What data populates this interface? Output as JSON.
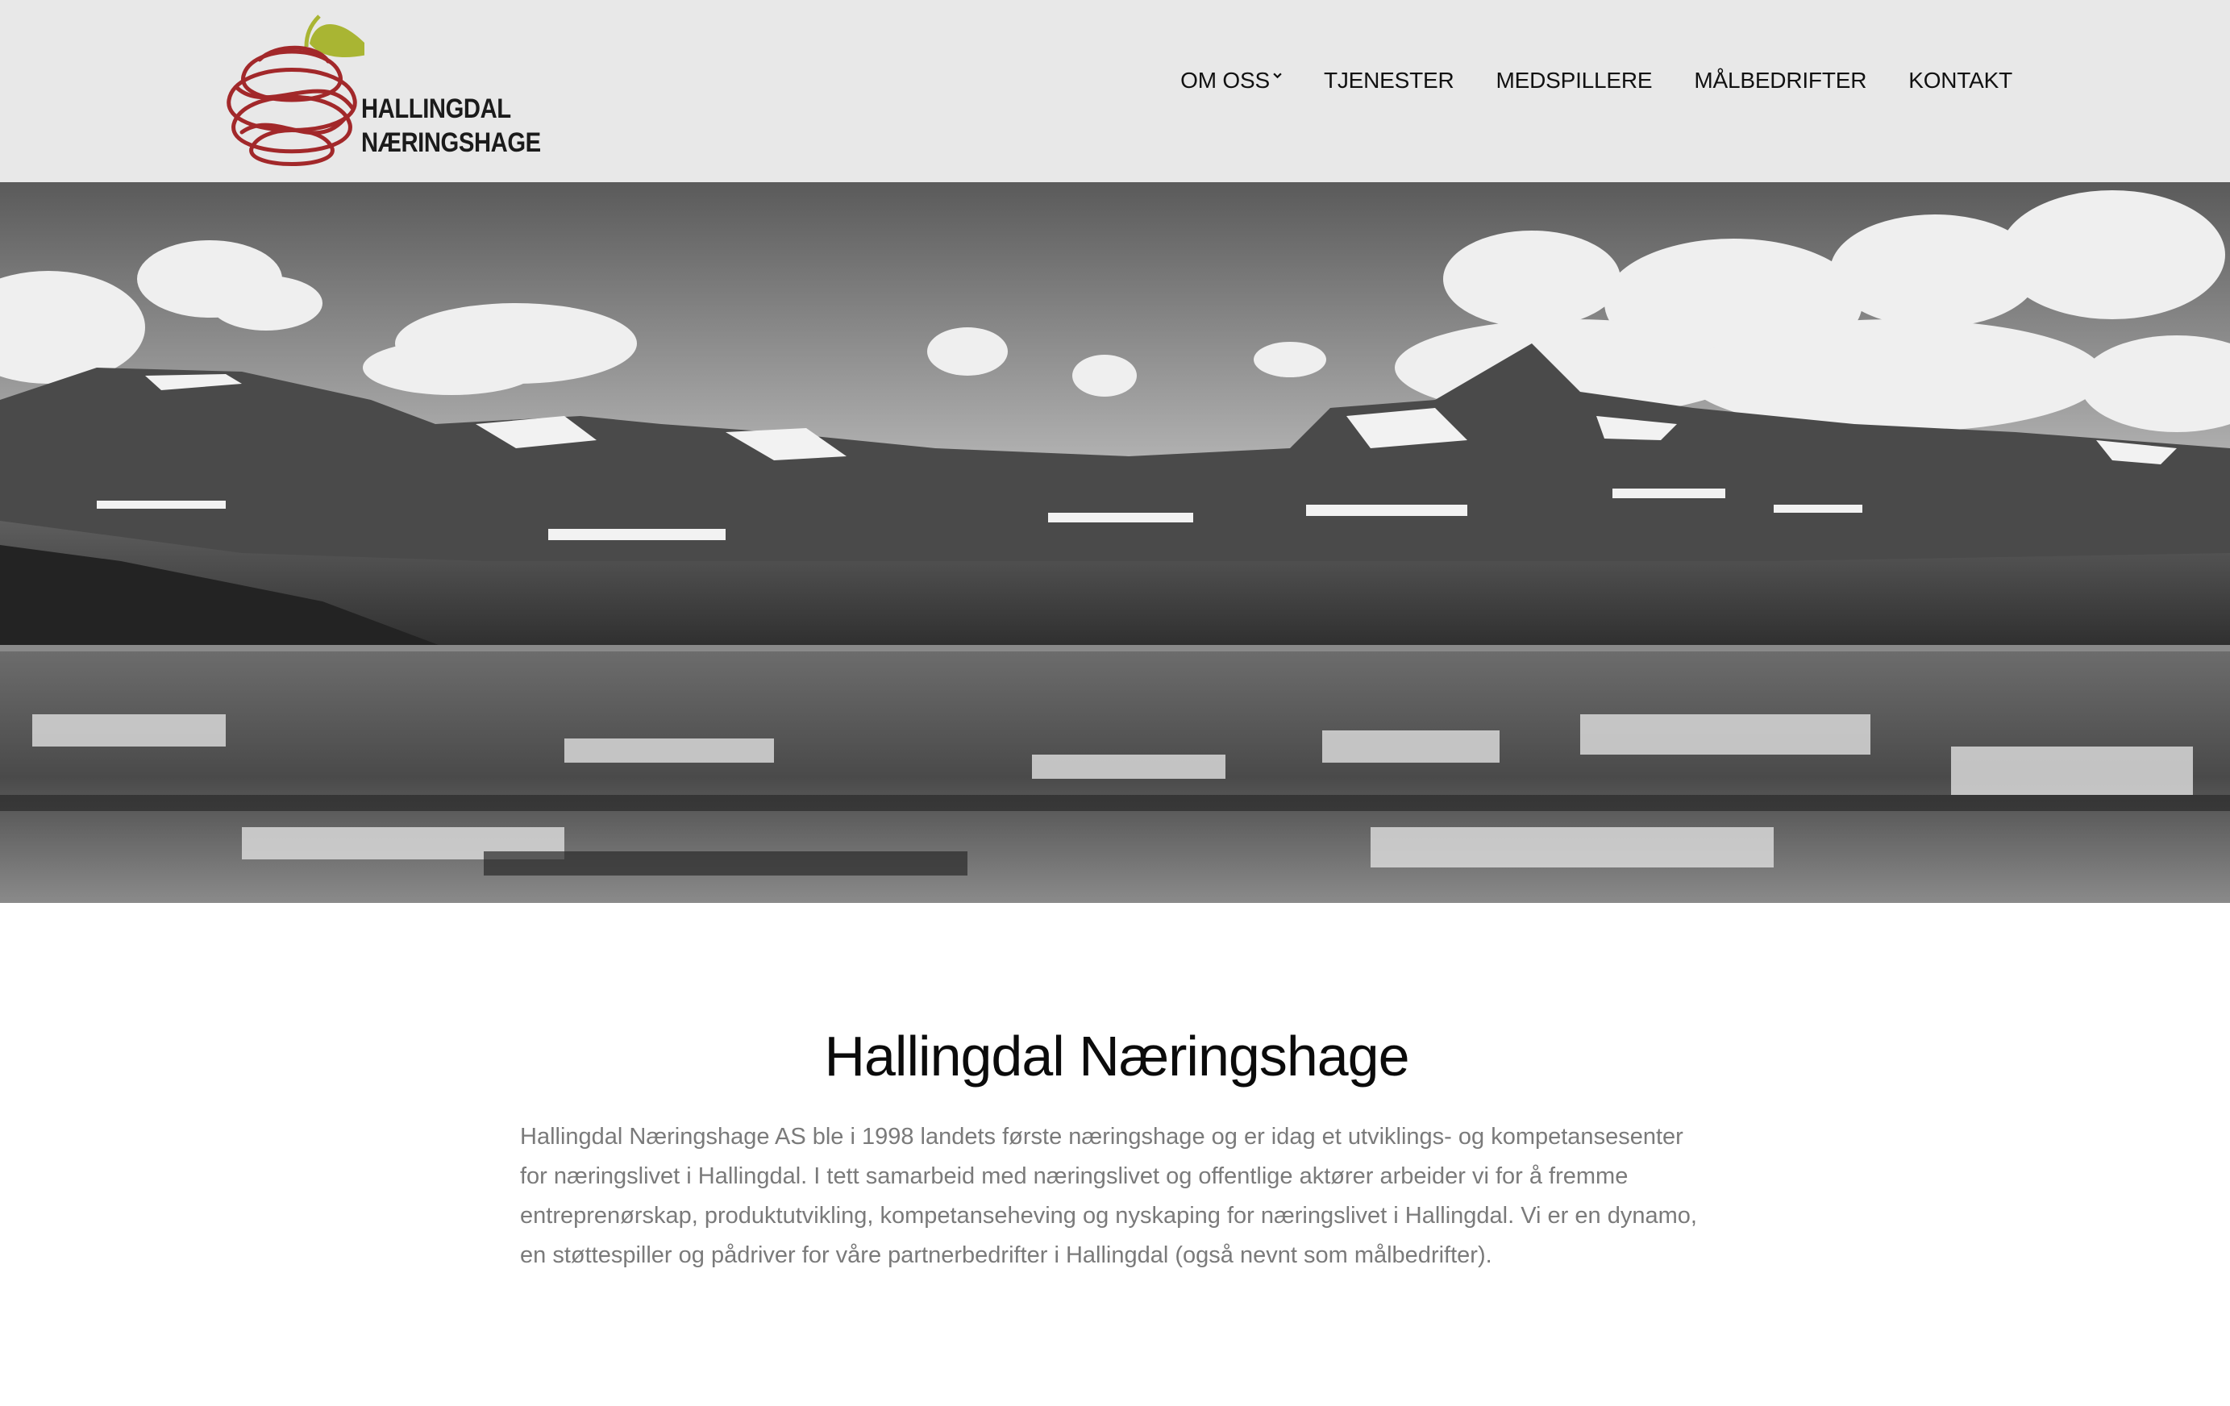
{
  "header": {
    "logo": {
      "line1": "HALLINGDAL",
      "line2": "NÆRINGSHAGE",
      "icon": "apple-spiral-logo",
      "colors": {
        "spiral": "#a2282a",
        "leaf": "#a9b533"
      }
    },
    "nav": [
      {
        "label": "OM OSS",
        "has_dropdown": true
      },
      {
        "label": "TJENESTER"
      },
      {
        "label": "MEDSPILLERE"
      },
      {
        "label": "MÅLBEDRIFTER"
      },
      {
        "label": "KONTAKT"
      }
    ],
    "background": "#e8e8e8"
  },
  "hero": {
    "image": "black-and-white mountain lake landscape with clouds and reflection"
  },
  "main": {
    "title": "Hallingdal Næringshage",
    "intro": "Hallingdal Næringshage AS ble i 1998 landets første næringshage og er idag et utviklings- og kompetansesenter for næringslivet i Hallingdal. I tett samarbeid med næringslivet og offentlige aktører arbeider vi for å fremme entreprenørskap, produktutvikling, kompetanseheving og nyskaping for næringslivet i Hallingdal. Vi er en dynamo, en støttespiller og pådriver for våre partnerbedrifter i Hallingdal (også nevnt som målbedrifter)."
  }
}
